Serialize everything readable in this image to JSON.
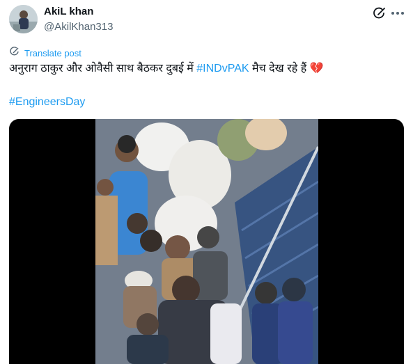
{
  "author": {
    "name": "AkiL khan",
    "handle": "@AkilKhan313"
  },
  "translate": {
    "label": "Translate post"
  },
  "post": {
    "text_before": "अनुराग ठाकुर और ओवैसी साथ बैठकर दुबई में ",
    "hashtag_inline": "#INDvPAK",
    "text_after": " मैच देख रहे हैं ",
    "emoji": "💔",
    "hashtag_second": "#EngineersDay"
  },
  "icons": {
    "grok": "grok-icon",
    "more": "more-icon",
    "translate": "globe-icon"
  },
  "colors": {
    "accent": "#1d9bf0",
    "text": "#0f1419",
    "secondary": "#536471",
    "heart": "#e0245e"
  }
}
